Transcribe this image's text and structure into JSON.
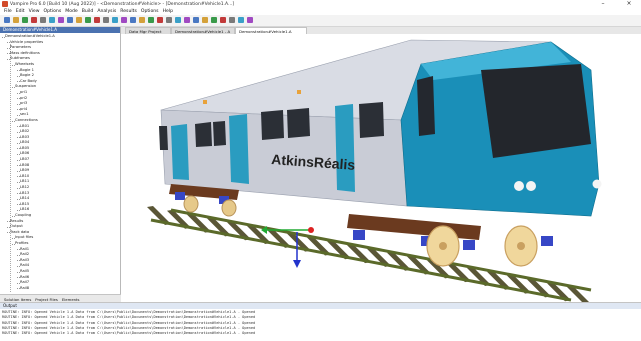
{
  "window": {
    "title": "Vampire Pro 6.0 [Build 10 (Aug 2022)] - <Demonstration#Vehicle> - [Demonstration#Vehicle1.A...]",
    "minimize_glyph": "–",
    "close_glyph": "×"
  },
  "menu": [
    "File",
    "Edit",
    "View",
    "Options",
    "Mode",
    "Build",
    "Analysis",
    "Results",
    "Options",
    "Help"
  ],
  "toolbar_icons": [
    "new-file-icon",
    "open-icon",
    "save-icon",
    "print-icon",
    "cut-icon",
    "copy-icon",
    "paste-icon",
    "undo-icon",
    "redo-icon",
    "run-icon",
    "stop-icon",
    "play-icon",
    "pause-icon",
    "zoom-in-icon",
    "zoom-out-icon",
    "zoom-fit-icon",
    "rotate-icon",
    "pan-icon",
    "select-icon",
    "wheel-icon",
    "rail-icon",
    "spring-icon",
    "damper-icon",
    "mass-icon",
    "joint-icon",
    "plot-icon",
    "table-icon",
    "help-icon"
  ],
  "left_panel": {
    "title": "Demonstration#Vehicle1.A",
    "tree": [
      "Demonstration#Vehicle1.A",
      "Vehicle properties",
      "Parameters",
      "Mass definitions",
      "Subframes",
      "Wheelsets",
      "Bogie 1",
      "Bogie 2",
      "Car Body",
      "Suspension",
      "pri1",
      "pri2",
      "pri3",
      "pri4",
      "sec1",
      "Connections",
      "LB01",
      "LB02",
      "LB03",
      "LB04",
      "LB05",
      "LB06",
      "LB07",
      "LB08",
      "LB09",
      "LB10",
      "LB11",
      "LB12",
      "LB13",
      "LB14",
      "LB15",
      "LB16",
      "Coupling",
      "Results",
      "Output",
      "Track data",
      "Input files",
      "Profiles",
      "Rail1",
      "Rail2",
      "Rail3",
      "Rail4",
      "Rail5",
      "Rail6",
      "Rail7",
      "Rail8"
    ],
    "tabs": [
      "Solution Items",
      "Project Files",
      "Elements"
    ]
  },
  "doc_tabs": [
    "Data Mgr Project",
    "Demonstration#Vehicle1 - A",
    "Demonstration#Vehicle1.A"
  ],
  "brand_text": "AtkinsRéalis",
  "output": {
    "title": "Output",
    "lines": [
      "ROUTINE: INFO: Opened Vehicle 1.A Data from C:\\Users\\Public\\Documents\\Demonstration\\Demonstration#Vehicle1.A - Opened",
      "ROUTINE: INFO: Opened Vehicle 1.A Data from C:\\Users\\Public\\Documents\\Demonstration\\Demonstration#Vehicle1.A - Opened",
      "ROUTINE: INFO: Opened Vehicle 1.A Data from C:\\Users\\Public\\Documents\\Demonstration\\Demonstration#Vehicle1.A - Opened",
      "ROUTINE: INFO: Opened Vehicle 1.A Data from C:\\Users\\Public\\Documents\\Demonstration\\Demonstration#Vehicle1.A - Opened",
      "ROUTINE: INFO: Opened Vehicle 1.A Data from C:\\Users\\Public\\Documents\\Demonstration\\Demonstration#Vehicle1.A - Opened"
    ]
  },
  "colors": {
    "carbody": "#c9ccd6",
    "accent": "#1a8fb8",
    "door": "#2a9cc0",
    "window": "#2b2f36",
    "bogie": "#6b3a1f",
    "spring": "#3747c6",
    "wheel": "#e6c98a",
    "track": "#6b7a3a",
    "sleeper": "#5a5636",
    "panel_header": "#4b72b0"
  }
}
